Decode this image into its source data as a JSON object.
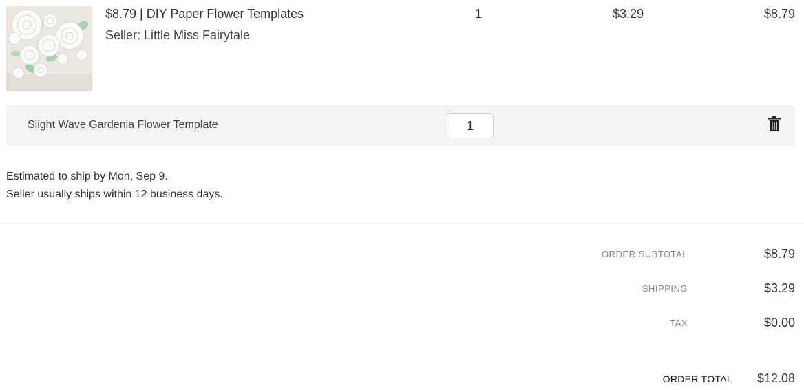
{
  "product": {
    "image_alt": "paper-flowers-thumbnail",
    "title": "$8.79 | DIY Paper Flower Templates",
    "seller": "Seller: Little Miss Fairytale",
    "quantity": "1",
    "shipping": "$3.29",
    "price": "$8.79"
  },
  "variant": {
    "label": "Slight Wave Gardenia Flower Template",
    "quantity_value": "1",
    "remove_icon": "trash-icon"
  },
  "shipping_estimate": {
    "line1": "Estimated to ship by Mon, Sep 9.",
    "line2": "Seller usually ships within 12 business days."
  },
  "summary": {
    "subtotal_label": "ORDER SUBTOTAL",
    "subtotal_value": "$8.79",
    "shipping_label": "SHIPPING",
    "shipping_value": "$3.29",
    "tax_label": "TAX",
    "tax_value": "$0.00",
    "total_label": "ORDER TOTAL",
    "total_value": "$12.08"
  }
}
